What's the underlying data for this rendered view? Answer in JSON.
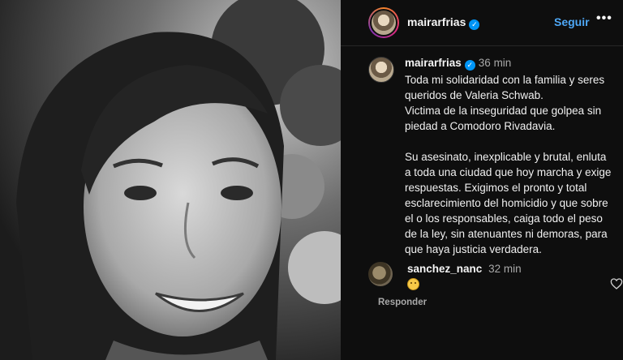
{
  "header": {
    "username": "mairarfrias",
    "follow_label": "Seguir",
    "more_label": "•••"
  },
  "caption": {
    "username": "mairarfrias",
    "time": "36 min",
    "lines": [
      "Toda mi solidaridad con la familia y seres",
      "queridos de Valeria Schwab.",
      "Victima de la inseguridad que golpea sin",
      "piedad a Comodoro Rivadavia."
    ],
    "lines2": [
      "Su asesinato, inexplicable y brutal, enluta",
      "a toda una ciudad que hoy marcha y exige",
      "respuestas. Exigimos el pronto y total",
      "esclarecimiento del homicidio y que sobre",
      "el o los responsables, caiga todo el peso",
      "de la ley, sin atenuantes ni demoras, para",
      "que haya justicia verdadera."
    ]
  },
  "comment": {
    "username": "sanchez_nanc",
    "time": "32 min",
    "emoji": "sad-face",
    "reply_label": "Responder"
  },
  "colors": {
    "link": "#4ea8f7",
    "verified": "#0095f6",
    "background": "#0e0e0e"
  }
}
